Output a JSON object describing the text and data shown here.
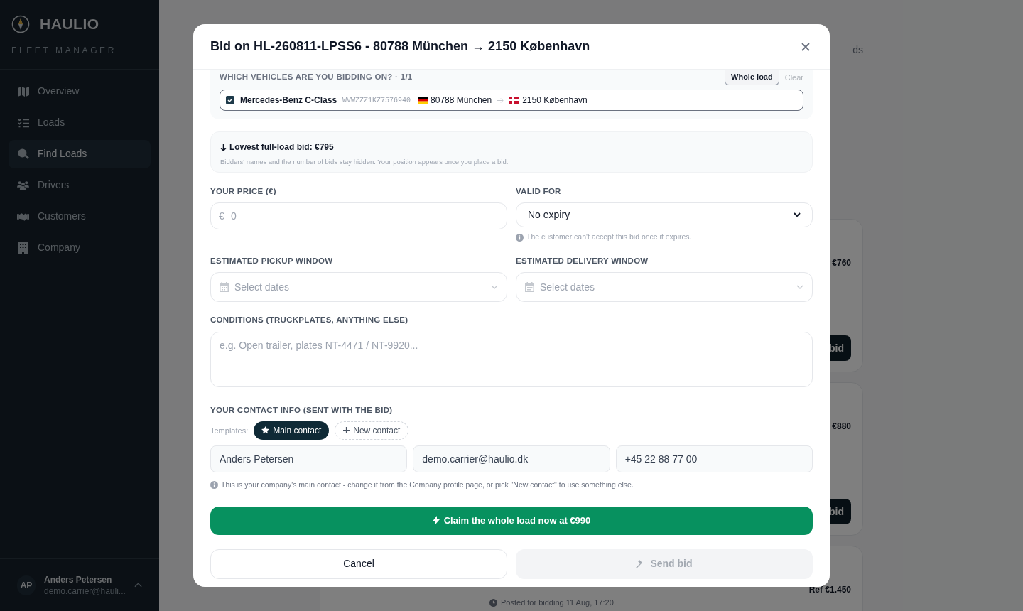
{
  "sidebar": {
    "brand": "HAULIO",
    "subtitle": "FLEET MANAGER",
    "items": [
      {
        "label": "Overview",
        "selected": false
      },
      {
        "label": "Loads",
        "selected": false
      },
      {
        "label": "Find Loads",
        "selected": true
      },
      {
        "label": "Drivers",
        "selected": false
      },
      {
        "label": "Customers",
        "selected": false
      },
      {
        "label": "Company",
        "selected": false
      }
    ],
    "user": {
      "initials": "AP",
      "name": "Anders Petersen",
      "email": "demo.carrier@hauli..."
    }
  },
  "background": {
    "tab_fragment": "ds",
    "cards": [
      {
        "price": "€760",
        "button": "bid"
      },
      {
        "price": "€880",
        "button": "bid"
      },
      {
        "price": "Ref €1.450"
      }
    ],
    "posted": "Posted for bidding 11 Aug, 17:20"
  },
  "modal": {
    "title": "Bid on HL-260811-LPSS6 - 80788 München → 2150 København",
    "vehicles": {
      "label": "WHICH VEHICLES ARE YOU BIDDING ON? · 1/1",
      "whole_load": "Whole load",
      "clear": "Clear",
      "items": [
        {
          "checked": true,
          "name": "Mercedes-Benz C-Class",
          "vin": "WVWZZZ1KZ7576940",
          "from": "80788 München",
          "to": "2150 København"
        }
      ]
    },
    "lowest": {
      "text": "Lowest full-load bid: €795",
      "note": "Bidders' names and the number of bids stay hidden. Your position appears once you place a bid."
    },
    "price": {
      "label": "YOUR PRICE (€)",
      "currency": "€",
      "placeholder": "0"
    },
    "valid_for": {
      "label": "VALID FOR",
      "value": "No expiry",
      "hint": "The customer can't accept this bid once it expires."
    },
    "pickup": {
      "label": "ESTIMATED PICKUP WINDOW",
      "placeholder": "Select dates"
    },
    "delivery": {
      "label": "ESTIMATED DELIVERY WINDOW",
      "placeholder": "Select dates"
    },
    "conditions": {
      "label": "CONDITIONS (TRUCKPLATES, ANYTHING ELSE)",
      "placeholder": "e.g. Open trailer, plates NT-4471 / NT-9920..."
    },
    "contact": {
      "label": "YOUR CONTACT INFO (SENT WITH THE BID)",
      "templates_label": "Templates:",
      "templates": [
        {
          "kind": "main",
          "label": "Main contact",
          "selected": true
        },
        {
          "kind": "new",
          "label": "New contact",
          "selected": false
        }
      ],
      "fields": [
        "Anders Petersen",
        "demo.carrier@haulio.dk",
        "+45 22 88 77 00"
      ],
      "note": "This is your company's main contact - change it from the Company profile page, or pick \"New contact\" to use something else."
    },
    "claim_button": "Claim the whole load now at €990",
    "cancel_button": "Cancel",
    "send_button": {
      "label": "Send bid",
      "disabled": true
    }
  }
}
